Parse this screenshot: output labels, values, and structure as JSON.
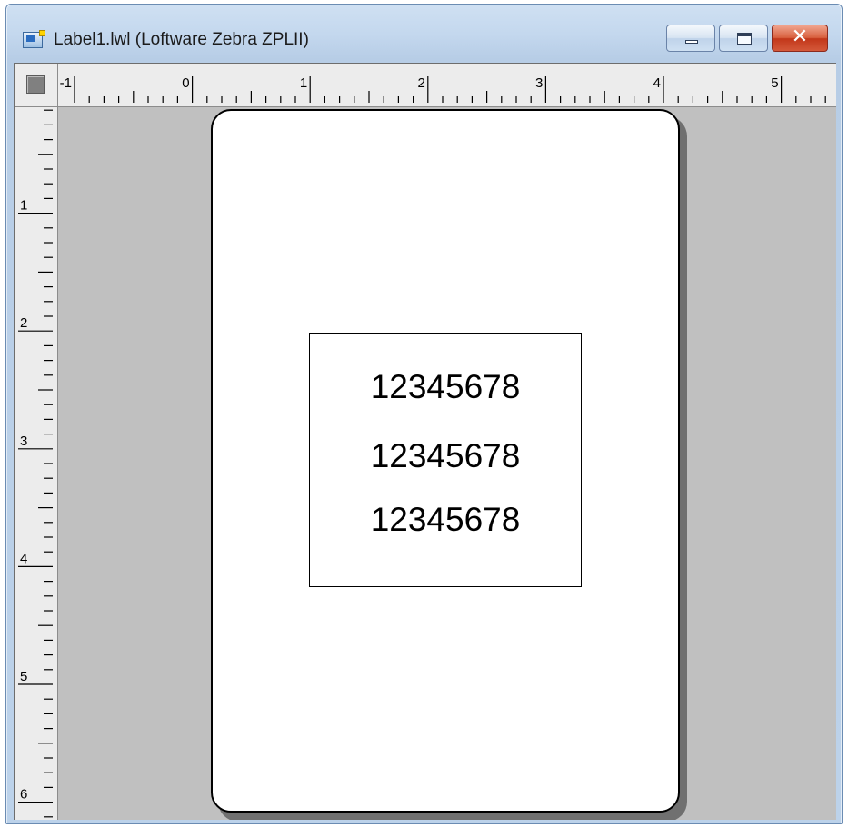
{
  "window": {
    "title": "Label1.lwl (Loftware Zebra ZPLII)",
    "icon": "label-document-icon",
    "controls": {
      "minimize": "minimize-icon",
      "maximize": "maximize-icon",
      "close": "close-icon",
      "close_glyph": "✕"
    }
  },
  "rulers": {
    "horizontal_labels": [
      "-1",
      "0",
      "1",
      "2",
      "3",
      "4",
      "5"
    ],
    "vertical_labels": [
      "1",
      "2",
      "3",
      "4",
      "5",
      "6"
    ]
  },
  "label": {
    "fields": [
      "12345678",
      "12345678",
      "12345678"
    ]
  },
  "colors": {
    "workspace": "#c0c0c0",
    "page": "#ffffff",
    "close_button": "#c2371a"
  }
}
